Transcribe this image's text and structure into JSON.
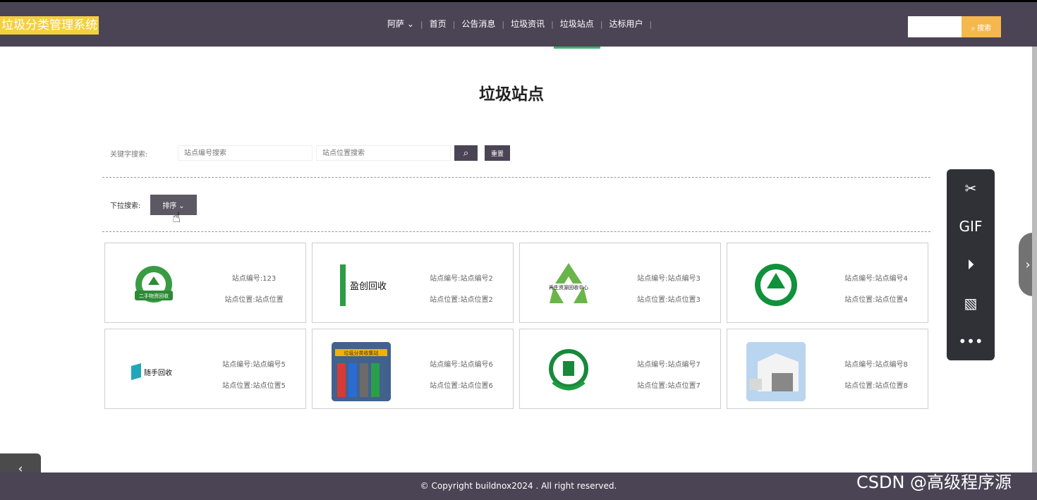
{
  "app": {
    "brand": "垃圾分类管理系统"
  },
  "nav": {
    "items": [
      {
        "label": "阿萨 ⌄"
      },
      {
        "label": "首页"
      },
      {
        "label": "公告消息"
      },
      {
        "label": "垃圾资讯"
      },
      {
        "label": "垃圾站点"
      },
      {
        "label": "达标用户"
      }
    ],
    "separator": "|"
  },
  "header_search": {
    "value": "",
    "button_label": "⌕ 搜索"
  },
  "page": {
    "title": "垃圾站点"
  },
  "filters": {
    "keyword_label": "关键字搜索:",
    "station_no_placeholder": "站点编号搜索",
    "location_placeholder": "站点位置搜索",
    "reset_label": "重置",
    "dropdown_label": "下拉搜索:",
    "sort_label": "排序 ⌄"
  },
  "stations": [
    {
      "no": "站点编号:123",
      "location": "站点位置:站点位置",
      "image_text": "二手物资回收"
    },
    {
      "no": "站点编号:站点编号2",
      "location": "站点位置:站点位置2",
      "image_text": "盈创回收"
    },
    {
      "no": "站点编号:站点编号3",
      "location": "站点位置:站点位置3",
      "image_text": "再生资源回收中心"
    },
    {
      "no": "站点编号:站点编号4",
      "location": "站点位置:站点位置4",
      "image_text": ""
    },
    {
      "no": "站点编号:站点编号5",
      "location": "站点位置:站点位置5",
      "image_text": "随手回收"
    },
    {
      "no": "站点编号:站点编号6",
      "location": "站点位置:站点位置6",
      "image_text": "垃圾分类收集站"
    },
    {
      "no": "站点编号:站点编号7",
      "location": "站点位置:站点位置7",
      "image_text": ""
    },
    {
      "no": "站点编号:站点编号8",
      "location": "站点位置:站点位置8",
      "image_text": ""
    }
  ],
  "tools": {
    "gif": "GIF",
    "more": "•••"
  },
  "footer": {
    "copyright": "© Copyright buildnox2024 . All right reserved."
  },
  "watermark": "CSDN @高级程序源",
  "colors": {
    "header": "#4b4455",
    "brand_bg": "#f4d03f",
    "accent": "#f5b84e",
    "active": "#3db36d"
  }
}
